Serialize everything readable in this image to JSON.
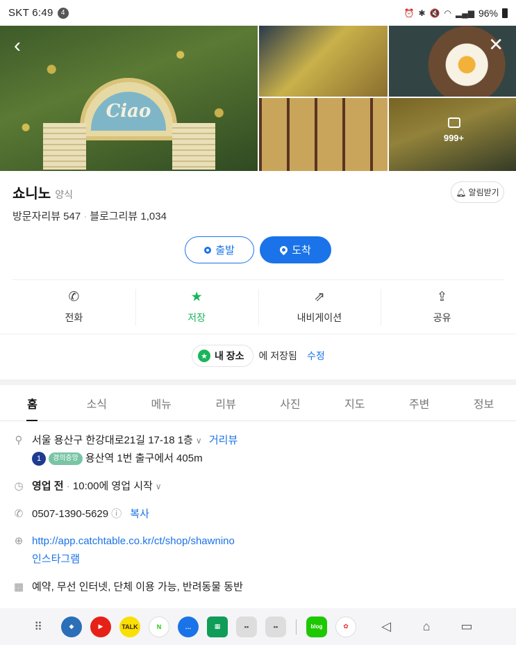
{
  "status_bar": {
    "carrier_time": "SKT 6:49",
    "notif_count": "4",
    "battery": "96%"
  },
  "gallery": {
    "sign_text": "Ciao",
    "more_count": "999+"
  },
  "place": {
    "name": "쇼니노",
    "category": "양식",
    "alarm_label": "알림받기",
    "visitor_reviews": "방문자리뷰 547",
    "blog_reviews": "블로그리뷰 1,034"
  },
  "route": {
    "start_label": "출발",
    "arrive_label": "도착"
  },
  "actions": [
    {
      "label": "전화",
      "icon": "phone-icon"
    },
    {
      "label": "저장",
      "icon": "star-icon"
    },
    {
      "label": "내비게이션",
      "icon": "navigation-icon"
    },
    {
      "label": "공유",
      "icon": "share-icon"
    }
  ],
  "saved": {
    "folder": "내 장소",
    "text": "에 저장됨",
    "edit": "수정"
  },
  "tabs": [
    "홈",
    "소식",
    "메뉴",
    "리뷰",
    "사진",
    "지도",
    "주변",
    "정보"
  ],
  "info": {
    "address": "서울 용산구 한강대로21길 17-18 1층",
    "street_view": "거리뷰",
    "subway_line_no": "1",
    "subway_line_name": "경의중앙",
    "subway_directions": "용산역 1번 출구에서 405m",
    "hours_status": "영업 전",
    "hours_detail": "10:00에 영업 시작",
    "phone": "0507-1390-5629",
    "copy": "복사",
    "website": "http://app.catchtable.co.kr/ct/shop/shawnino",
    "instagram": "인스타그램",
    "amenities": "예약, 무선 인터넷, 단체 이용 가능, 반려동물 동반"
  },
  "dock_apps": [
    "blog"
  ]
}
